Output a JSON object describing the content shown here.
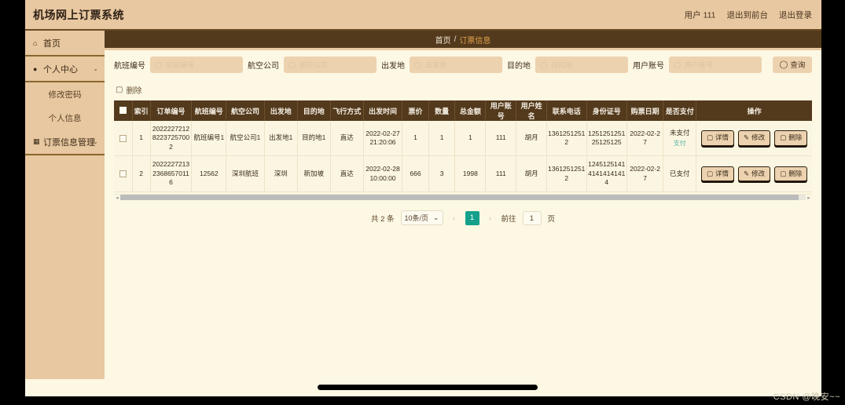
{
  "header": {
    "brand": "机场网上订票系统",
    "user_label": "用户 111",
    "exit_front": "退出到前台",
    "logout": "退出登录"
  },
  "sidebar": {
    "items": [
      {
        "label": "首页",
        "icon": "home-icon",
        "caret": ""
      },
      {
        "label": "个人中心",
        "icon": "user-icon",
        "caret": "⌄"
      },
      {
        "label": "修改密码",
        "icon": "",
        "caret": ""
      },
      {
        "label": "个人信息",
        "icon": "",
        "caret": ""
      },
      {
        "label": "订票信息管理",
        "icon": "grid-icon",
        "caret": "⌄"
      }
    ]
  },
  "breadcrumb": {
    "home": "首页",
    "sep": "/",
    "current": "订票信息"
  },
  "search": {
    "fields": [
      {
        "label": "航班编号",
        "placeholder": "航班编号",
        "value": ""
      },
      {
        "label": "航空公司",
        "placeholder": "航空公司",
        "value": ""
      },
      {
        "label": "出发地",
        "placeholder": "出发地",
        "value": ""
      },
      {
        "label": "目的地",
        "placeholder": "目的地",
        "value": ""
      },
      {
        "label": "用户账号",
        "placeholder": "用户账号",
        "value": ""
      }
    ],
    "button": "查询"
  },
  "toolbar": {
    "delete_label": "删除"
  },
  "table": {
    "columns": [
      "",
      "索引",
      "订单编号",
      "航班编号",
      "航空公司",
      "出发地",
      "目的地",
      "飞行方式",
      "出发时间",
      "票价",
      "数量",
      "总金额",
      "用户账号",
      "用户姓名",
      "联系电话",
      "身份证号",
      "购票日期",
      "是否支付",
      "操作"
    ],
    "rows": [
      {
        "index": "1",
        "order_no": "202222721282237257002",
        "flight_no": "航班编号1",
        "airline": "航空公司1",
        "origin": "出发地1",
        "destination": "目的地1",
        "flight_type": "直达",
        "depart_time": "2022-02-27 21:20:06",
        "price": "1",
        "quantity": "1",
        "total": "1",
        "account": "111",
        "name": "胡月",
        "phone": "13612512512",
        "id_card": "125125125125125125",
        "buy_date": "2022-02-27",
        "paid": "未支付",
        "pay_link": "支付",
        "ops": [
          "详情",
          "修改",
          "删除"
        ]
      },
      {
        "index": "2",
        "order_no": "202222721323686570116",
        "flight_no": "12562",
        "airline": "深圳航班",
        "origin": "深圳",
        "destination": "新加坡",
        "flight_type": "直达",
        "depart_time": "2022-02-28 10:00:00",
        "price": "666",
        "quantity": "3",
        "total": "1998",
        "account": "111",
        "name": "胡月",
        "phone": "13612512512",
        "id_card": "124512514141414141414",
        "buy_date": "2022-02-27",
        "paid": "已支付",
        "pay_link": "",
        "ops": [
          "详情",
          "修改",
          "删除"
        ]
      }
    ]
  },
  "pagination": {
    "total_text": "共 2 条",
    "page_size": "10条/页",
    "prev": "‹",
    "next": "›",
    "current_page": "1",
    "goto_label": "前往",
    "goto_value": "1",
    "page_unit": "页"
  },
  "watermark": "CSDN @晚安~~",
  "colors": {
    "brand_bg": "#e8c8a0",
    "dark": "#533a1d",
    "page_bg": "#fdf8e4",
    "accent_teal": "#15a08c",
    "breadcrumb_current": "#e0a04a"
  }
}
